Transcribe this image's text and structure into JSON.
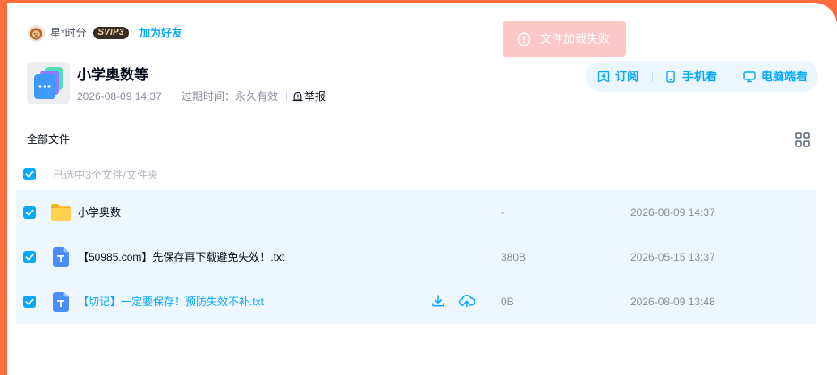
{
  "colors": {
    "page_background": "#fe6b3d",
    "accent": "#06a7ff",
    "toast_background": "#fcc7c7",
    "row_background": "#eff7fe"
  },
  "user": {
    "avatar_icon": "lion-avatar-icon",
    "name": "星*时分",
    "badge": "SVIP3",
    "add_friend": "加为好友"
  },
  "toast": {
    "icon": "alert-circle-icon",
    "message": "文件加载失败"
  },
  "share": {
    "icon": "shared-files-icon",
    "title": "小学奥数等",
    "created": "2026-08-09 14:37",
    "expire": "过期时间：永久有效",
    "report_icon": "report-icon",
    "report": "举报"
  },
  "actions": [
    {
      "icon": "subscribe-icon",
      "label": "订阅"
    },
    {
      "icon": "phone-icon",
      "label": "手机看"
    },
    {
      "icon": "desktop-icon",
      "label": "电脑端看"
    }
  ],
  "file_list": {
    "breadcrumb": "全部文件",
    "view_toggle_icon": "grid-view-icon",
    "select_all_checked": true,
    "selection_summary": "已选中3个文件/文件夹",
    "rows": [
      {
        "icon": "folder-icon",
        "name": "小学奥数",
        "size": "-",
        "modified": "2026-08-09 14:37",
        "checked": true
      },
      {
        "icon": "txt-file-icon",
        "name": "【50985.com】先保存再下载避免失效！.txt",
        "size": "380B",
        "modified": "2026-05-15 13:37",
        "checked": true
      },
      {
        "icon": "txt-file-icon",
        "name": "【切记】一定要保存！预防失效不补.txt",
        "size": "0B",
        "modified": "2026-08-09 13:48",
        "checked": true,
        "hovered": true,
        "hover_actions": [
          {
            "icon": "download-icon"
          },
          {
            "icon": "save-to-cloud-icon"
          }
        ]
      }
    ]
  }
}
